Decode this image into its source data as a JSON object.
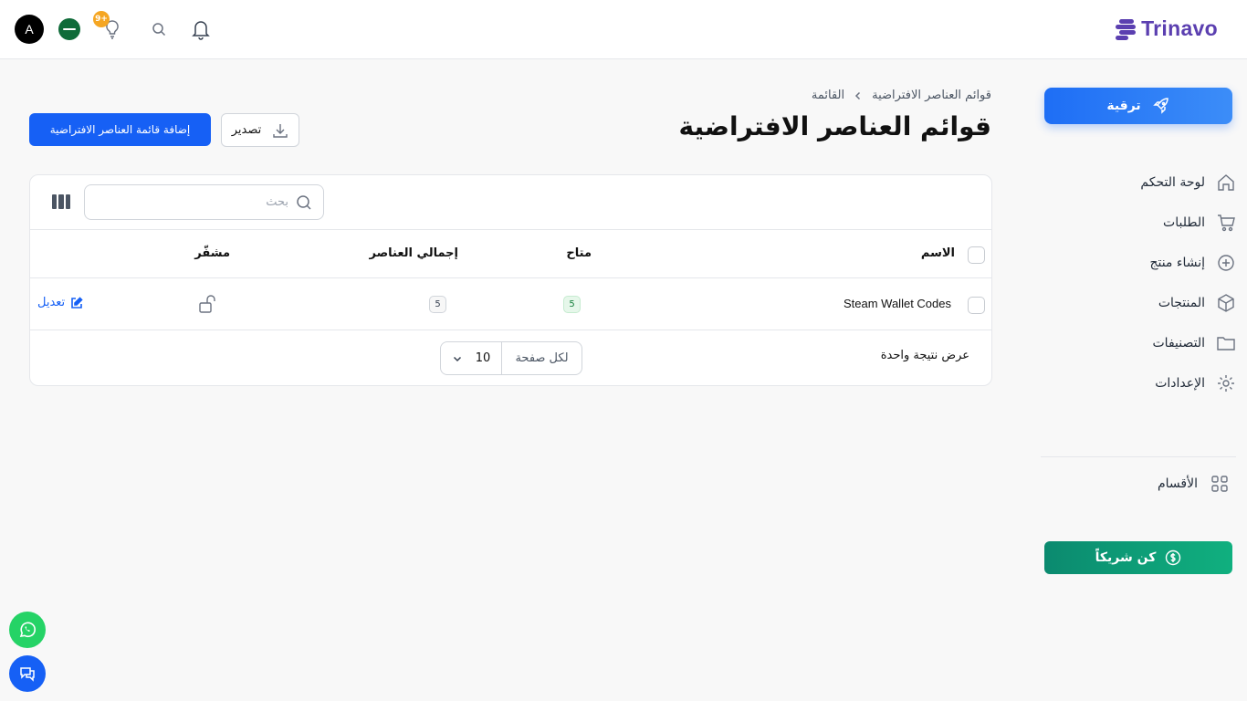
{
  "brand": {
    "name": "Trinavo",
    "color": "#5b3fb0"
  },
  "topbar": {
    "avatar_initial": "A",
    "notification_badge": "9+",
    "icons": [
      "flag-icon",
      "lightbulb-icon",
      "search-icon",
      "bell-icon"
    ]
  },
  "sidebar": {
    "upgrade_label": "ترقية",
    "items": [
      {
        "label": "لوحة التحكم",
        "icon": "home-icon"
      },
      {
        "label": "الطلبات",
        "icon": "cart-icon"
      },
      {
        "label": "إنشاء منتج",
        "icon": "plus-circle-icon"
      },
      {
        "label": "المنتجات",
        "icon": "box-icon"
      },
      {
        "label": "التصنيفات",
        "icon": "folder-icon"
      },
      {
        "label": "الإعدادات",
        "icon": "gear-icon"
      }
    ],
    "sections_label": "الأقسام",
    "partner_label": "كن شريكاً"
  },
  "header": {
    "breadcrumb": [
      "قوائم العناصر الافتراضية",
      "القائمة"
    ],
    "title": "قوائم العناصر الافتراضية",
    "export_label": "تصدير",
    "add_label": "إضافة قائمة العناصر الافتراضية"
  },
  "table": {
    "search_placeholder": "بحث",
    "columns": [
      "الاسم",
      "متاح",
      "إجمالي العناصر",
      "مشفّر"
    ],
    "rows": [
      {
        "name": "Steam Wallet Codes",
        "available": "5",
        "total": "5",
        "encrypted": "unlocked",
        "edit_label": "تعديل"
      }
    ],
    "results_text": "عرض نتيجة واحدة",
    "per_page_label": "لكل صفحة",
    "per_page_value": "10"
  },
  "colors": {
    "primary": "#1660f5",
    "partner": "#0b8a6f",
    "available_badge": "#16803c"
  }
}
